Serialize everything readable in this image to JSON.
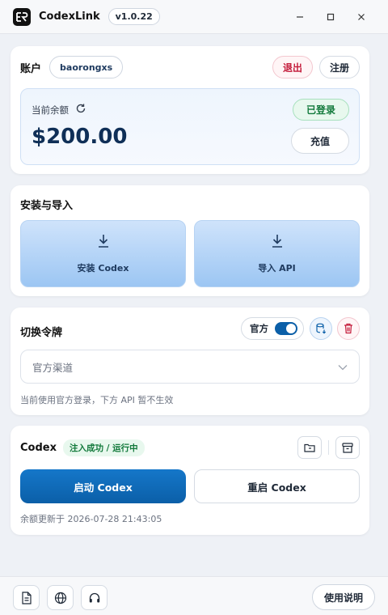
{
  "app": {
    "title": "CodexLink",
    "version": "v1.0.22",
    "window_controls": [
      "minimize-icon",
      "maximize-icon",
      "close-icon"
    ]
  },
  "account": {
    "title": "账户",
    "username": "baorongxs",
    "logout_label": "退出",
    "register_label": "注册",
    "balance_label": "当前余额",
    "balance_value": "$200.00",
    "login_status": "已登录",
    "recharge_label": "充值"
  },
  "install": {
    "title": "安装与导入",
    "install_label": "安装 Codex",
    "import_label": "导入 API"
  },
  "token": {
    "title": "切换令牌",
    "official_label": "官方",
    "official_enabled": true,
    "select_value": "官方渠道",
    "hint": "当前使用官方登录，下方 API 暂不生效"
  },
  "codex": {
    "title": "Codex",
    "status": "注入成功 / 运行中",
    "start_label": "启动 Codex",
    "restart_label": "重启 Codex",
    "updated": "余额更新于 2026-07-28 21:43:05"
  },
  "footer": {
    "icons": [
      "document-icon",
      "globe-icon",
      "headset-icon"
    ],
    "help_label": "使用说明"
  },
  "colors": {
    "primary": "#0b5fa8",
    "danger": "#c41d3c",
    "success": "#137a3c",
    "background": "#eef1f6"
  }
}
